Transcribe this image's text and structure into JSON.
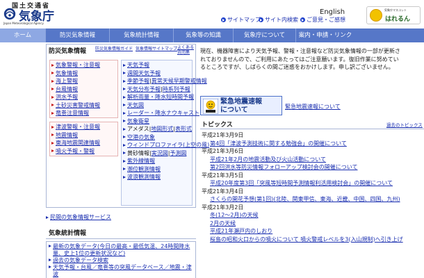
{
  "header": {
    "ministry": "国土交通省",
    "title": "気象庁",
    "subtitle": "Japan Meteorological Agency",
    "links": [
      {
        "label": "サイトマップ"
      },
      {
        "label": "サイト内検索"
      },
      {
        "label": "ご意見・ご感想"
      }
    ],
    "english": "English",
    "mascot_small": "気象庁マスコット",
    "mascot_name": "はれるん"
  },
  "nav": {
    "items": [
      {
        "label": "ホーム",
        "active": true
      },
      {
        "label": "防災気象情報"
      },
      {
        "label": "気象統計情報"
      },
      {
        "label": "気象等の知識"
      },
      {
        "label": "気象庁について"
      },
      {
        "label": "案内・申請・リンク"
      }
    ]
  },
  "bosai": {
    "title": "防災気象情報",
    "guide_link": "防災気象情報ガイド",
    "map_link": "気象情報サイトマップ",
    "yoku_link_1": "よくある",
    "yoku_link_2": "質問集",
    "group1": [
      "気象警報・注意報",
      "気象情報",
      "海上警報",
      "台風情報",
      "洪水予報",
      "土砂災害警戒情報",
      "竜巻注意情報"
    ],
    "group2": [
      "津波警報・注意報",
      "地震情報",
      "東海地震関連情報",
      "噴火予報・警報"
    ],
    "right_group": [
      "天気予報",
      "週間天気予報",
      "季節予報",
      "異常天候早期警戒情報",
      "天気分布予報",
      "時系列予報",
      "解析雨量・降水短時間予報",
      "天気図",
      "レーダー・降水ナウキャスト",
      "気象衛星",
      "アメダス",
      "地図形式",
      "表形式",
      "空港の気象",
      "ウィンドプロファイラ(上空の風)",
      "黄砂情報",
      "実況図",
      "予測図",
      "紫外線情報",
      "潮位観測情報",
      "波浪観測情報"
    ]
  },
  "minkan_link": "民間の気象情報サービス",
  "toukei": {
    "title": "気象統計情報",
    "items": [
      "最新の気象データ(今日の最高・最低気温、24時間降水量、史上1位の更新状況など)",
      "過去の気象データ検索",
      "天気予報・台風／竜巻等の突風データベース／地震・津波"
    ]
  },
  "notice": "現在、機器障害により天気予報、警報・注意報など防災気象情報の一部が更新されておりませんので、ご利用にあたってはご注意願います。復旧作業に努めているところですが、しばらくの間ご迷惑をおかけします。申し訳ございません。",
  "eew": {
    "title_1": "緊急地震速報",
    "title_2": "について",
    "link": "緊急地震速報について"
  },
  "topics": {
    "title": "トピックス",
    "past_link": "過去のトピックス",
    "entries": [
      {
        "date": "平成21年3月9日",
        "items": [
          "第4回「津波予測技術に関する勉強会」の開催について"
        ]
      },
      {
        "date": "平成21年3月6日",
        "items": [
          "平成21年2月の地震活動及び火山活動について",
          "第2回洪水等防災情報フォローアップ検討会の開催について"
        ]
      },
      {
        "date": "平成21年3月5日",
        "items": [
          "平成20年度第3回「突風等短時間予測情報利活用検討会」の開催について"
        ]
      },
      {
        "date": "平成21年3月4日",
        "items": [
          "さくらの開花予想(第1回)(北陸、関東甲信、東海、近畿、中国、四国、九州)"
        ]
      },
      {
        "date": "平成21年3月2日",
        "items": [
          "冬(12〜2月)の天候",
          "2月の天候",
          "平成21年瀬戸内のしおり",
          "桜島の昭和火口からの噴火について 噴火警戒レベルを3(入山規制)へ引き上げ"
        ]
      }
    ]
  },
  "colors": {
    "nav_bg": "#5677c8",
    "nav_active": "#8ea8e3",
    "link": "#1a2fb0",
    "alert_bullet": "#c51a1a"
  }
}
